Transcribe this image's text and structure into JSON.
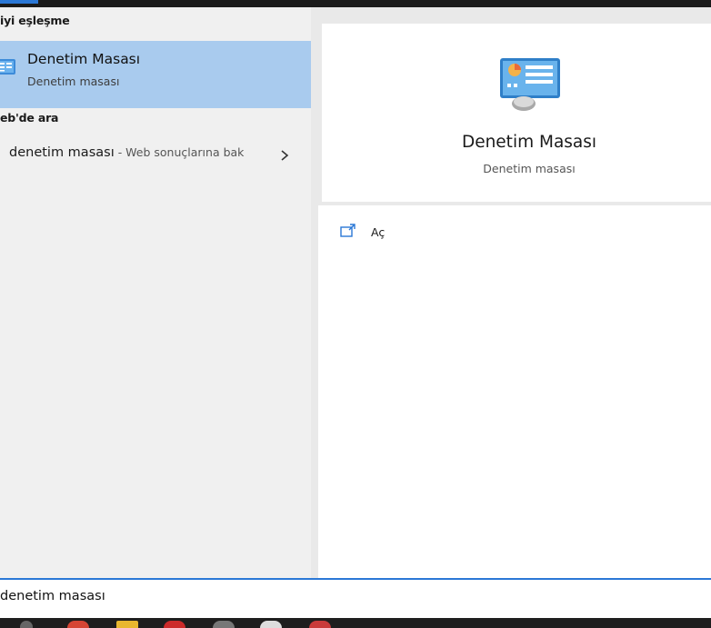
{
  "best_match": {
    "header": "iyi eşleşme",
    "title": "Denetim Masası",
    "subtitle": "Denetim masası"
  },
  "web_search": {
    "header": "eb'de ara",
    "query": "denetim masası",
    "suffix": " - Web sonuçlarına bak"
  },
  "detail": {
    "title": "Denetim Masası",
    "subtitle": "Denetim masası",
    "actions": [
      {
        "label": "Aç",
        "icon": "open-icon"
      }
    ]
  },
  "search_box": {
    "value": "denetim masası"
  },
  "icons": {
    "app": "control-panel-icon",
    "chevron": "chevron-right-icon"
  },
  "colors": {
    "accent": "#2b78d6",
    "selected_bg": "#a9cbee",
    "pane_bg": "#f0f0f0",
    "taskbar_bg": "#1e1e1e"
  }
}
